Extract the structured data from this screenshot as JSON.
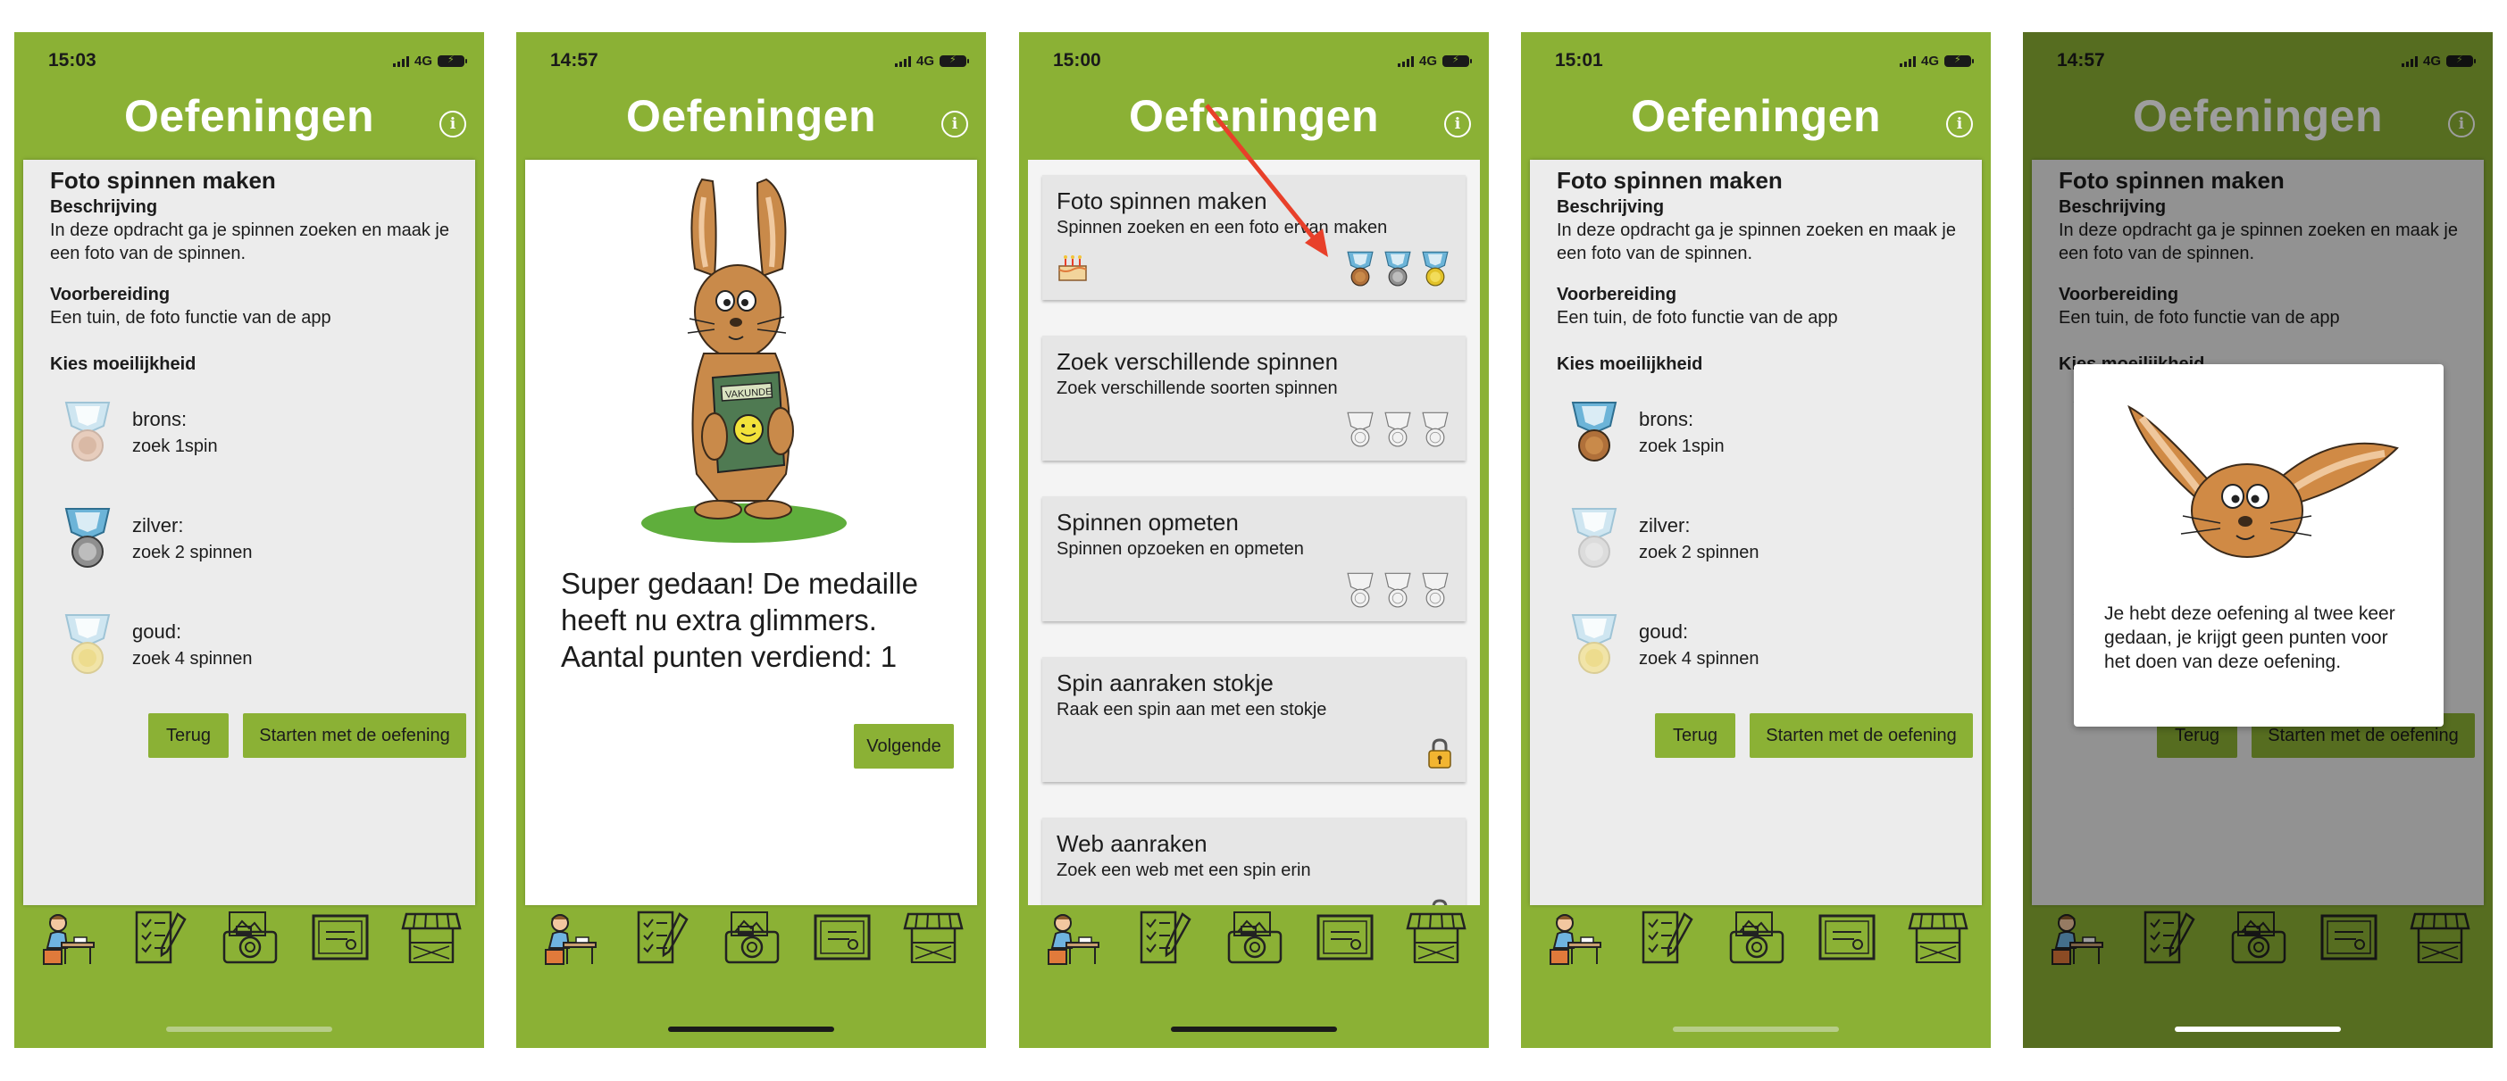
{
  "app_title": "Oefeningen",
  "network": "4G",
  "battery_symbol": "⚡",
  "nav_icons": [
    "student-desk-icon",
    "checklist-icon",
    "camera-icon",
    "certificate-icon",
    "market-stall-icon"
  ],
  "detail": {
    "exercise_title": "Foto spinnen maken",
    "description_heading": "Beschrijving",
    "description": "In deze opdracht ga je spinnen zoeken en maak je een foto van de spinnen.",
    "preparation_heading": "Voorbereiding",
    "preparation": "Een tuin, de foto functie van de app",
    "difficulty_heading": "Kies moeilijkheid",
    "levels": [
      {
        "name": "brons:",
        "desc": "zoek 1spin"
      },
      {
        "name": "zilver:",
        "desc": "zoek 2 spinnen"
      },
      {
        "name": "goud:",
        "desc": "zoek 4 spinnen"
      }
    ],
    "back_label": "Terug",
    "start_label": "Starten met de oefening"
  },
  "screens": [
    {
      "time": "15:03"
    },
    {
      "time": "14:57"
    },
    {
      "time": "15:00"
    },
    {
      "time": "15:01"
    },
    {
      "time": "14:57"
    }
  ],
  "success": {
    "message": "Super gedaan! De medaille heeft nu extra glimmers. Aantal punten verdiend: 1",
    "next_label": "Volgende",
    "book_label": "VAKUNDE"
  },
  "exercise_list": [
    {
      "title": "Foto spinnen maken",
      "subtitle": "Spinnen zoeken en een foto ervan maken",
      "status": "medals-earned"
    },
    {
      "title": "Zoek verschillende spinnen",
      "subtitle": "Zoek verschillende soorten spinnen",
      "status": "medals-empty"
    },
    {
      "title": "Spinnen opmeten",
      "subtitle": "Spinnen opzoeken en opmeten",
      "status": "medals-empty"
    },
    {
      "title": "Spin aanraken stokje",
      "subtitle": "Raak een spin aan met een stokje",
      "status": "locked"
    },
    {
      "title": "Web aanraken",
      "subtitle": "Zoek een web met een spin erin",
      "status": "locked"
    }
  ],
  "popup": {
    "message": "Je hebt deze oefening al twee keer gedaan, je krijgt geen punten voor het doen van deze oefening."
  },
  "colors": {
    "brand_green": "#8bb135",
    "bronze": "#b0703a",
    "silver": "#9a9a9a",
    "gold": "#e2c229",
    "ribbon_blue": "#6cb4d8",
    "arrow_red": "#e8402a"
  }
}
